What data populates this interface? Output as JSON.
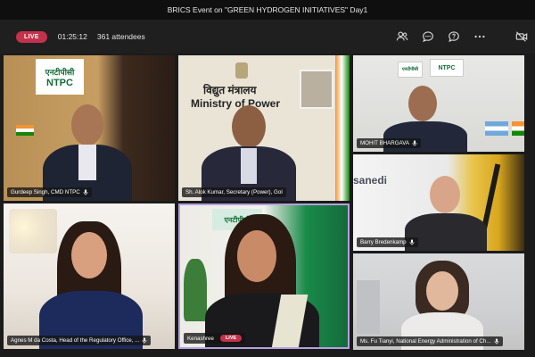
{
  "window": {
    "title": "BRICS Event on \"GREEN HYDROGEN INITIATIVES\" Day1"
  },
  "toolbar": {
    "live_label": "LIVE",
    "elapsed": "01:25:12",
    "attendees": "361 attendees",
    "icons": [
      "people-icon",
      "chat-icon",
      "qa-icon",
      "more-icon",
      "camera-off-icon"
    ]
  },
  "tiles": [
    {
      "name": "Gurdeep Singh, CMD NTPC",
      "logo_top": "एनटीपीसी",
      "logo_bottom": "NTPC"
    },
    {
      "name": "Sh. Alok Kumar, Secretary (Power), GoI",
      "sign_hindi": "विद्युत मंत्रालय",
      "sign_english": "Ministry of Power"
    },
    {
      "name": "MOHIT BHARGAVA",
      "logo_left": "एनटीपीसी",
      "logo_right": "NTPC"
    },
    {
      "name": "Barry Bredenkamp",
      "logo": "sanedi"
    },
    {
      "name": "Agnes M da Costa, Head of the Regulatory Office, ..."
    },
    {
      "name": "Kenashree",
      "live_label": "LIVE",
      "logo_top": "एनटीपीसी"
    },
    {
      "name": "Ms. Fu Tianyi, National Energy Administration of Ch..."
    }
  ],
  "colors": {
    "live": "#c4314b",
    "ntpc_green": "#156c3a",
    "active_border": "#b5a0e0"
  }
}
